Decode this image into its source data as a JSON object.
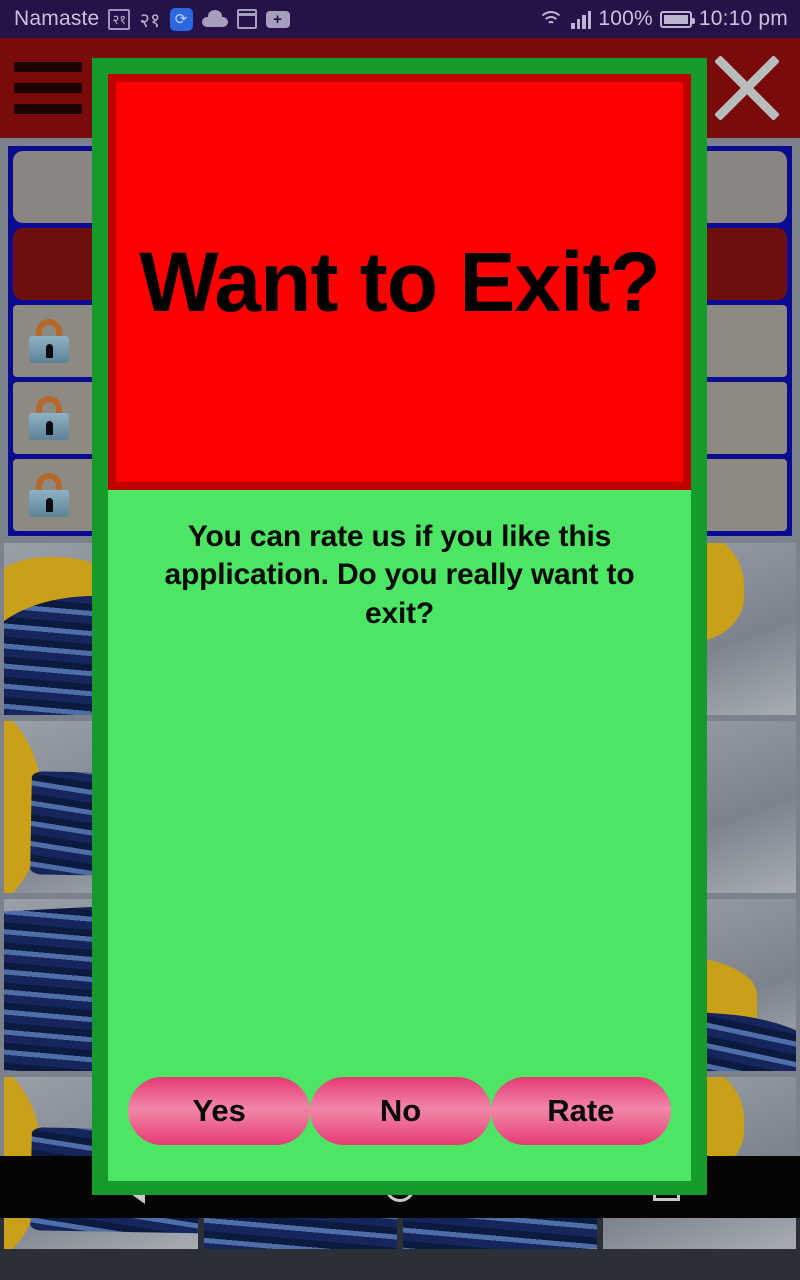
{
  "statusbar": {
    "carrier": "Namaste",
    "carrier_badge": "२१",
    "extra_text": "२१",
    "icons": [
      "sync-icon",
      "cloud-icon",
      "calendar-icon",
      "add-icon"
    ],
    "wifi_icon": "wifi-icon",
    "signal_icon": "signal-bars-icon",
    "battery_percent": "100%",
    "battery_icon": "battery-full-icon",
    "time": "10:10 pm",
    "bg_color": "#241249",
    "fg_color": "#c9c2dd"
  },
  "background_app": {
    "header": {
      "menu_icon": "hamburger-menu-icon",
      "close_icon": "close-x-icon",
      "bg_color": "#7a0b0b"
    },
    "list": {
      "border_color": "#0b0b8f",
      "rows": [
        {
          "name": "row-gray",
          "style": "gray",
          "lock": false
        },
        {
          "name": "row-dark-red",
          "style": "darkred",
          "lock": false
        },
        {
          "name": "row-locked-1",
          "style": "locked",
          "lock": true
        },
        {
          "name": "row-locked-2",
          "style": "locked",
          "lock": true
        },
        {
          "name": "row-locked-3",
          "style": "locked",
          "lock": true
        }
      ]
    },
    "photo_grid": {
      "thumbnail_count": 16,
      "variants": [
        "v1",
        "v2",
        "v3",
        "v4",
        "v5",
        "v2",
        "v1",
        "v6",
        "v3",
        "v4",
        "v1",
        "v2",
        "v5",
        "v1",
        "v3",
        "v4"
      ]
    }
  },
  "dialog": {
    "title": "Want to Exit?",
    "message": "You can rate us if you like this application. Do you really want to exit?",
    "outer_border_color": "#149b2c",
    "title_panel_border_color": "#c00000",
    "title_panel_color": "#ff0000",
    "body_color": "#4ce664",
    "buttons": [
      {
        "id": "yes",
        "label": "Yes"
      },
      {
        "id": "no",
        "label": "No"
      },
      {
        "id": "rate",
        "label": "Rate"
      }
    ],
    "button_color": "#e73a74"
  },
  "navbar": {
    "back_icon": "back-triangle-icon",
    "home_icon": "home-circle-icon",
    "recents_icon": "recents-square-icon",
    "bg_color": "#050505"
  }
}
